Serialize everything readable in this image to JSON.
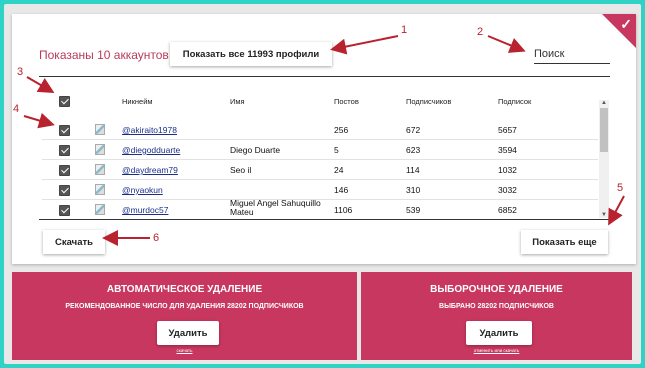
{
  "header": {
    "shown_text": "Показаны 10 аккаунтов",
    "show_all_label": "Показать все 11993 профили",
    "search_placeholder": "Поиск"
  },
  "table": {
    "columns": [
      "Никнейм",
      "Имя",
      "Постов",
      "Подписчиков",
      "Подписок"
    ],
    "rows": [
      {
        "nick": "@akiraito1978",
        "name": "",
        "posts": "256",
        "followers": "672",
        "following": "5657"
      },
      {
        "nick": "@diegodduarte",
        "name": "Diego Duarte",
        "posts": "5",
        "followers": "623",
        "following": "3594"
      },
      {
        "nick": "@daydream79",
        "name": "Seo il",
        "posts": "24",
        "followers": "114",
        "following": "1032"
      },
      {
        "nick": "@nyaokun",
        "name": "",
        "posts": "146",
        "followers": "310",
        "following": "3032"
      },
      {
        "nick": "@murdoc57",
        "name": "Miguel Angel Sahuquillo Mateu",
        "posts": "1106",
        "followers": "539",
        "following": "6852"
      }
    ]
  },
  "actions": {
    "download_label": "Скачать",
    "show_more_label": "Показать еще"
  },
  "auto_panel": {
    "title": "АВТОМАТИЧЕСКОЕ УДАЛЕНИЕ",
    "subtitle": "РЕКОМЕНДОВАННОЕ ЧИСЛО ДЛЯ УДАЛЕНИЯ 28202 ПОДПИСЧИКОВ",
    "button": "Удалить",
    "link": "скачать"
  },
  "selective_panel": {
    "title": "ВЫБОРОЧНОЕ УДАЛЕНИЕ",
    "subtitle": "ВЫБРАНО 28202 ПОДПИСЧИКОВ",
    "button": "Удалить",
    "link": "отменить или скачать"
  },
  "annotations": [
    "1",
    "2",
    "3",
    "4",
    "5",
    "6"
  ],
  "colors": {
    "accent": "#c8375f",
    "background": "#2fd3c6",
    "annotation": "#b8232f",
    "link": "#1b2f8a"
  },
  "icons": [
    "checkmark-icon",
    "broken-image-icon",
    "arrow-up-icon",
    "arrow-down-icon"
  ]
}
